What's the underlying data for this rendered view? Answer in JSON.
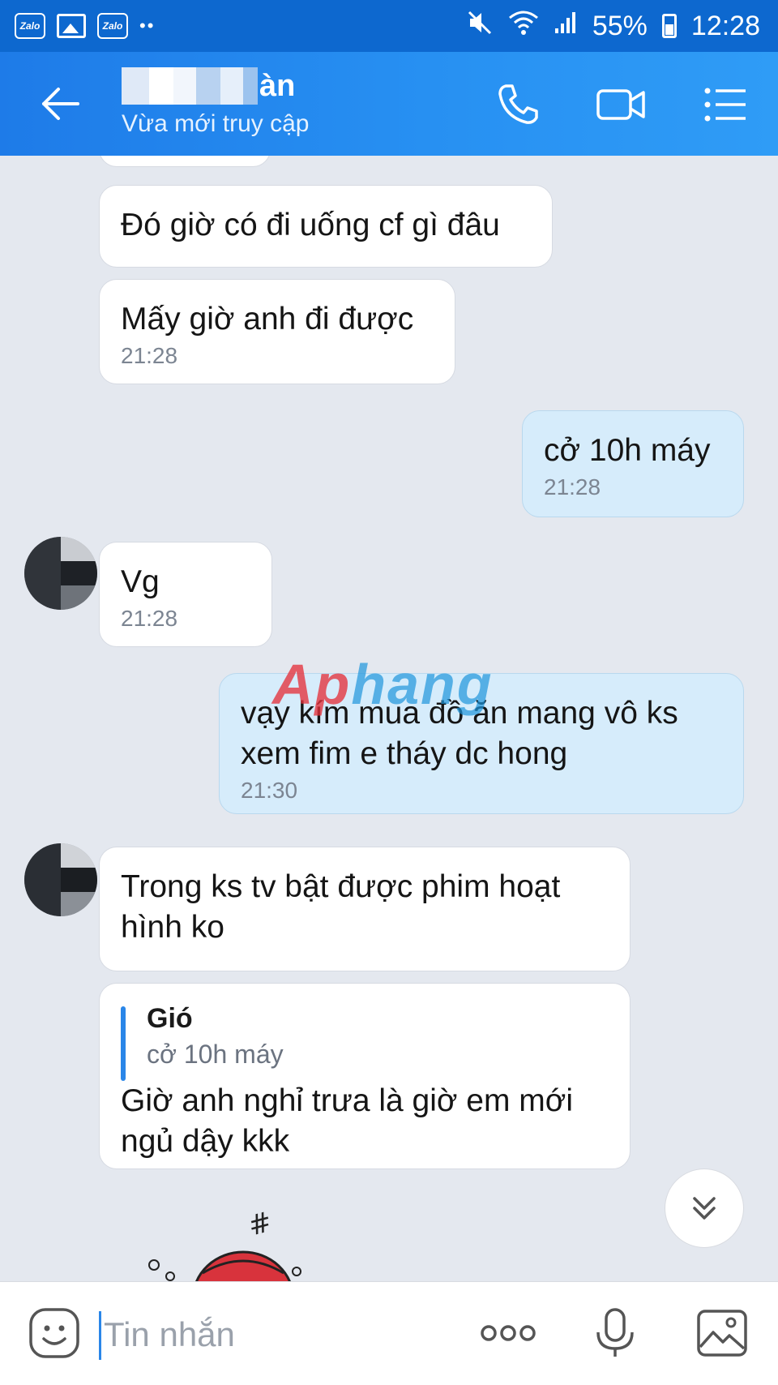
{
  "status_bar": {
    "app_icons": [
      "Zalo",
      "Zalo"
    ],
    "battery": "55%",
    "time": "12:28",
    "dots": "••"
  },
  "header": {
    "name_visible": "àn",
    "status": "Vừa mới truy cập"
  },
  "messages": [
    {
      "text": "Đó giờ có đi uống cf gì đâu",
      "time": ""
    },
    {
      "text": "Mấy giờ anh đi được",
      "time": "21:28"
    },
    {
      "text": "cở 10h máy",
      "time": "21:28"
    },
    {
      "text": "Vg",
      "time": "21:28"
    },
    {
      "text": "vạy kím mua đồ ăn mang vô ks xem fim e tháy dc hong",
      "time": "21:30"
    },
    {
      "text": "Trong ks tv bật được phim hoạt hình ko",
      "time": ""
    },
    {
      "quote_name": "Gió",
      "quote_text": "cở 10h máy",
      "text": "Giờ anh nghỉ trưa là giờ em mới ngủ dậy kkk",
      "time": ""
    }
  ],
  "watermark": {
    "part1": "Ap",
    "part2": "hang"
  },
  "input": {
    "placeholder": "Tin nhắn"
  },
  "colors": {
    "header": "#1e7be8",
    "status_bar": "#0d68cf",
    "outgoing": "#d6ecfb",
    "accent": "#2a86e8"
  }
}
